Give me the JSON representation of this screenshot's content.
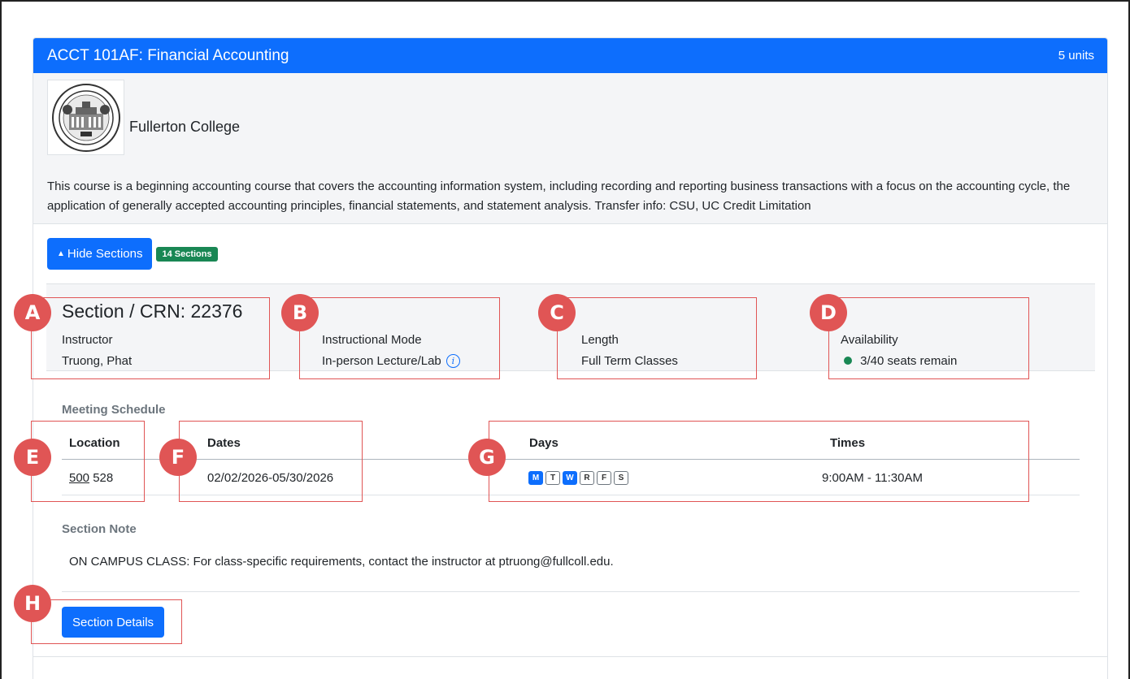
{
  "course": {
    "title": "ACCT 101AF: Financial Accounting",
    "units": "5 units",
    "college": "Fullerton College",
    "description": "This course is a beginning accounting course that covers the accounting information system, including recording and reporting business transactions with a focus on the accounting cycle, the application of generally accepted accounting principles, financial statements, and statement analysis. Transfer info: CSU, UC Credit Limitation"
  },
  "controls": {
    "hide_sections_label": "Hide Sections",
    "sections_badge": "14 Sections"
  },
  "section": {
    "crn_label": "Section / CRN: 22376",
    "instructor_label": "Instructor",
    "instructor_value": "Truong, Phat",
    "mode_label": "Instructional Mode",
    "mode_value": "In-person Lecture/Lab",
    "length_label": "Length",
    "length_value": "Full Term Classes",
    "availability_label": "Availability",
    "availability_value": "3/40 seats remain",
    "meeting_schedule_label": "Meeting Schedule",
    "table_headers": [
      "Location",
      "Dates",
      "Days",
      "Times"
    ],
    "location_building": "500",
    "location_room": "528",
    "dates": "02/02/2026-05/30/2026",
    "days": [
      {
        "letter": "M",
        "active": true
      },
      {
        "letter": "T",
        "active": false
      },
      {
        "letter": "W",
        "active": true
      },
      {
        "letter": "R",
        "active": false
      },
      {
        "letter": "F",
        "active": false
      },
      {
        "letter": "S",
        "active": false
      }
    ],
    "times": "9:00AM - 11:30AM",
    "note_label": "Section Note",
    "note_text": "ON CAMPUS CLASS: For class-specific requirements, contact the instructor at ptruong@fullcoll.edu.",
    "details_button": "Section Details"
  },
  "annotations": [
    "A",
    "B",
    "C",
    "D",
    "E",
    "F",
    "G",
    "H"
  ],
  "colors": {
    "primary": "#0d6efd",
    "success": "#198754",
    "annotation": "#e05555"
  }
}
